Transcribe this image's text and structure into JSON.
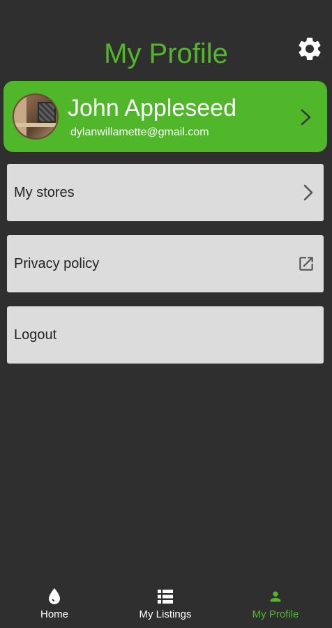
{
  "header": {
    "title": "My Profile",
    "settings_icon": "gear-icon"
  },
  "profile": {
    "name": "John Appleseed",
    "email": "dylanwillamette@gmail.com",
    "trailing_icon": "chevron-right-icon"
  },
  "menu": {
    "items": [
      {
        "label": "My stores",
        "trailing_icon": "chevron-right-icon"
      },
      {
        "label": "Privacy policy",
        "trailing_icon": "open-in-new-icon"
      },
      {
        "label": "Logout"
      }
    ]
  },
  "bottom_nav": {
    "items": [
      {
        "label": "Home",
        "icon": "drop-icon",
        "active": false
      },
      {
        "label": "My Listings",
        "icon": "list-icon",
        "active": false
      },
      {
        "label": "My Profile",
        "icon": "person-icon",
        "active": true
      }
    ]
  },
  "colors": {
    "background": "#2f2f2f",
    "accent": "#52b829",
    "card": "#50b62a",
    "menu_item": "#dcdcdc",
    "nav_inactive": "#ffffff"
  }
}
